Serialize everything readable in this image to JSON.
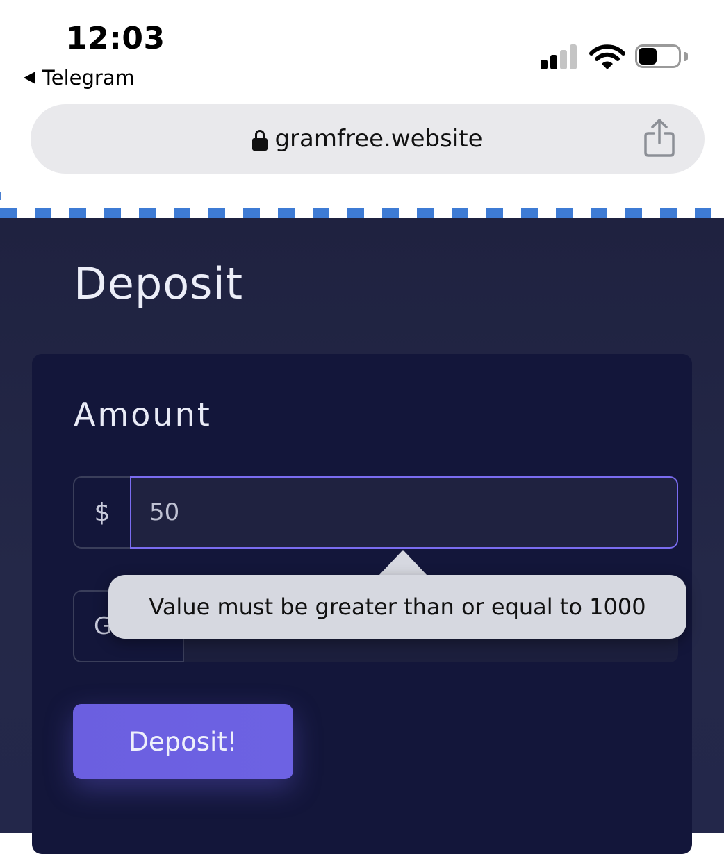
{
  "status_bar": {
    "time": "12:03",
    "back_app": "Telegram"
  },
  "browser": {
    "url": "gramfree.website"
  },
  "page": {
    "title": "Deposit",
    "form": {
      "amount_label": "Amount",
      "currency_symbol": "$",
      "amount_value": "50",
      "second_prefix": "G",
      "submit_label": "Deposit!"
    }
  },
  "validation": {
    "message": "Value must be greater than or equal to 1000"
  },
  "colors": {
    "accent": "#6b5fe0",
    "page_bg": "#1f2240",
    "card_bg": "#13163a",
    "url_bar_bg": "#e9e9ec"
  },
  "icons": [
    "lock-icon",
    "share-icon",
    "signal-icon",
    "wifi-icon",
    "battery-icon",
    "back-arrow-icon"
  ]
}
